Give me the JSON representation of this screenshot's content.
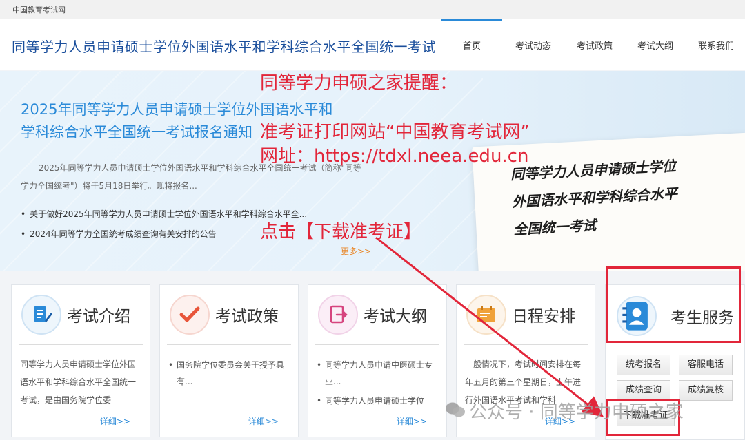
{
  "top_strip": {
    "site_name": "中国教育考试网"
  },
  "header": {
    "title": "同等学力人员申请硕士学位外国语水平和学科综合水平全国统一考试",
    "nav": [
      "首页",
      "考试动态",
      "考试政策",
      "考试大纲",
      "联系我们"
    ]
  },
  "banner": {
    "title_line1": "2025年同等学力人员申请硕士学位外国语水平和",
    "title_line2": "学科综合水平全国统一考试报名通知",
    "summary": "2025年同等学力人员申请硕士学位外国语水平和学科综合水平全国统一考试（简称\"同等学力全国统考\"）将于5月18日举行。现将报名...",
    "links": [
      "关于做好2025年同等学力人员申请硕士学位外国语水平和学科综合水平全...",
      "2024年同等学力全国统考成绩查询有关安排的公告"
    ],
    "more": "更多>>",
    "paper_line1": "同等学力人员申请硕士学位",
    "paper_line2": "外国语水平和学科综合水平",
    "paper_line3": "全国统一考试"
  },
  "annotations": {
    "reminder": "同等学力申硕之家提醒：",
    "site_line": "准考证打印网站“中国教育考试网”",
    "url_line": "网址：https://tdxl.neea.edu.cn",
    "click_line": "点击【下载准考证】"
  },
  "cards": [
    {
      "title": "考试介绍",
      "desc": "同等学力人员申请硕士学位外国语水平和学科综合水平全国统一考试，是由国务院学位委",
      "detail": "详细>>"
    },
    {
      "title": "考试政策",
      "items": [
        "国务院学位委员会关于授予具有..."
      ],
      "detail": "详细>>"
    },
    {
      "title": "考试大纲",
      "items": [
        "同等学力人员申请中医硕士专业...",
        "同等学力人员申请硕士学位"
      ],
      "detail": "详细>>"
    },
    {
      "title": "日程安排",
      "desc": "一般情况下，考试时间安排在每年五月的第三个星期日，上午进行外国语水平考试和学科",
      "detail": "详细>>"
    }
  ],
  "service": {
    "title": "考生服务",
    "buttons": [
      "统考报名",
      "客服电话",
      "成绩查询",
      "成绩复核",
      "下载准考证"
    ]
  },
  "watermark": "公众号 · 同等学力申硕之家",
  "colors": {
    "brand_blue": "#2a8ad8",
    "annotation_red": "#e2263a",
    "more_orange": "#e8882b"
  }
}
